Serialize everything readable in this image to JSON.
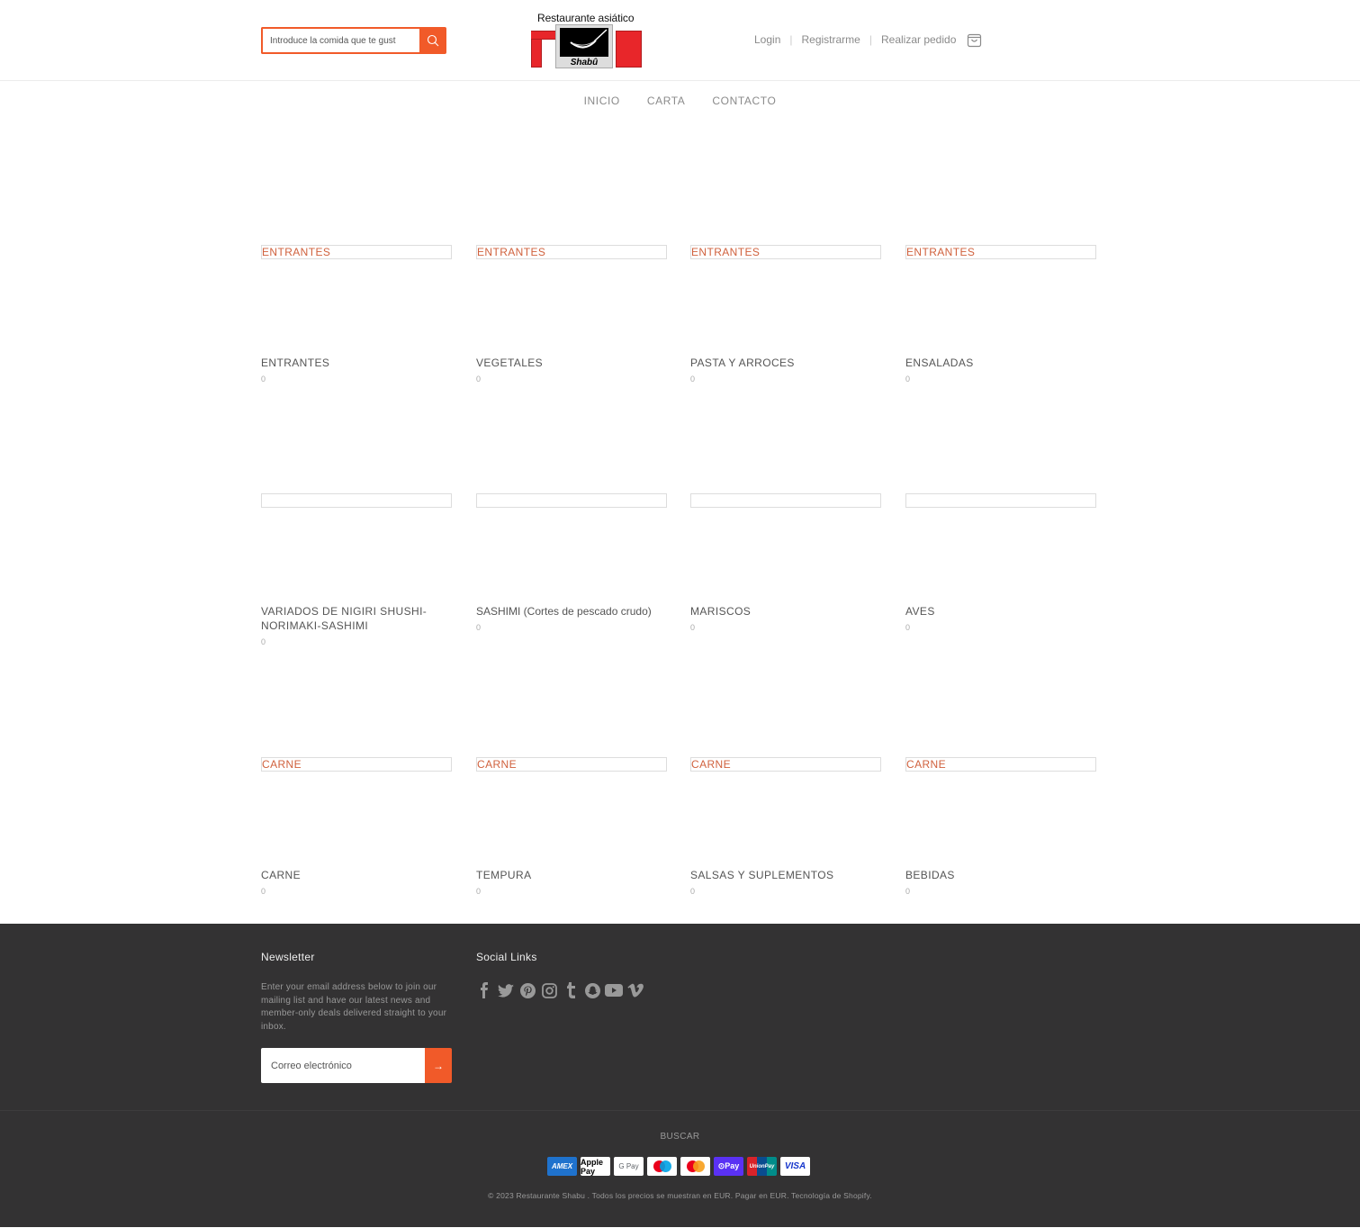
{
  "header": {
    "search": {
      "placeholder": "Introduce la comida que te gust",
      "icon": "search-icon"
    },
    "logo": {
      "tagline": "Restaurante  asiático",
      "brand": "Shabû"
    },
    "account_links": [
      "Login",
      "Registrarme",
      "Realizar pedido"
    ],
    "cart_icon": "shopping-bag-icon"
  },
  "nav": {
    "items": [
      "INICIO",
      "CARTA",
      "CONTACTO"
    ]
  },
  "collections": [
    {
      "banner": "ENTRANTES",
      "title": "ENTRANTES",
      "count": "0"
    },
    {
      "banner": "ENTRANTES",
      "title": "VEGETALES",
      "count": "0"
    },
    {
      "banner": "ENTRANTES",
      "title": "PASTA Y ARROCES",
      "count": "0"
    },
    {
      "banner": "ENTRANTES",
      "title": "ENSALADAS",
      "count": "0"
    },
    {
      "banner": "",
      "title": "VARIADOS DE NIGIRI SHUSHI-NORIMAKI-SASHIMI",
      "count": "0"
    },
    {
      "banner": "",
      "title": "SASHIMI (Cortes de pescado crudo)",
      "count": "0"
    },
    {
      "banner": "",
      "title": "MARISCOS",
      "count": "0"
    },
    {
      "banner": "",
      "title": "AVES",
      "count": "0"
    },
    {
      "banner": "CARNE",
      "title": "CARNE",
      "count": "0"
    },
    {
      "banner": "CARNE",
      "title": "TEMPURA",
      "count": "0"
    },
    {
      "banner": "CARNE",
      "title": "SALSAS Y SUPLEMENTOS",
      "count": "0"
    },
    {
      "banner": "CARNE",
      "title": "BEBIDAS",
      "count": "0"
    }
  ],
  "footer": {
    "newsletter": {
      "heading": "Newsletter",
      "text": "Enter your email address below to join our mailing list and have our latest news and member-only deals delivered straight to your inbox.",
      "email_placeholder": "Correo electrónico",
      "submit_label": "→"
    },
    "social": {
      "heading": "Social Links",
      "icons": [
        "facebook-icon",
        "twitter-icon",
        "pinterest-icon",
        "instagram-icon",
        "tumblr-icon",
        "snapchat-icon",
        "youtube-icon",
        "vimeo-icon"
      ]
    },
    "buscar": "BUSCAR",
    "payments": [
      "AMEX",
      "Apple Pay",
      "G Pay",
      "Maestro",
      "Mastercard",
      "Shop Pay",
      "UnionPay",
      "VISA"
    ],
    "copyright": "© 2023 Restaurante Shabu . Todos los precios se muestran en EUR. Pagar en EUR. Tecnología de Shopify."
  },
  "colors": {
    "accent": "#f15a29",
    "banner_text": "#d0613d",
    "footer_bg": "#333233",
    "logo_red": "#e8262a"
  }
}
